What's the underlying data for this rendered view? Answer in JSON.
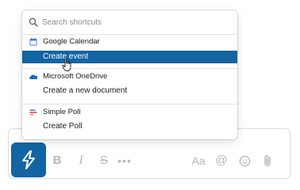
{
  "search": {
    "placeholder": "Search shortcuts",
    "value": ""
  },
  "groups": [
    {
      "app": "Google Calendar",
      "icon": "google-calendar-icon",
      "items": [
        {
          "label": "Create event",
          "selected": true
        }
      ]
    },
    {
      "app": "Microsoft OneDrive",
      "icon": "onedrive-icon",
      "items": [
        {
          "label": "Create a new document",
          "selected": false
        }
      ]
    },
    {
      "app": "Simple Poll",
      "icon": "simple-poll-icon",
      "items": [
        {
          "label": "Create Poll",
          "selected": false
        }
      ]
    }
  ],
  "toolbar": {
    "bold": "B",
    "italic": "I",
    "strike": "S",
    "more": "•••",
    "format": "Aa",
    "mention": "@"
  },
  "colors": {
    "accent": "#1264a3",
    "selected_text": "#ffffff",
    "muted_icon": "#b8b8b8"
  }
}
